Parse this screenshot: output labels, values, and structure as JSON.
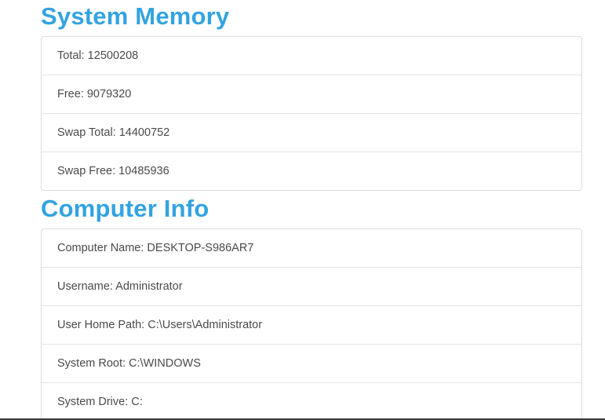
{
  "system_memory": {
    "title": "System Memory",
    "items": [
      "Total: 12500208",
      "Free: 9079320",
      "Swap Total: 14400752",
      "Swap Free: 10485936"
    ]
  },
  "computer_info": {
    "title": "Computer Info",
    "items": [
      "Computer Name: DESKTOP-S986AR7",
      "Username: Administrator",
      "User Home Path: C:\\Users\\Administrator",
      "System Root: C:\\WINDOWS",
      "System Drive: C:"
    ]
  }
}
